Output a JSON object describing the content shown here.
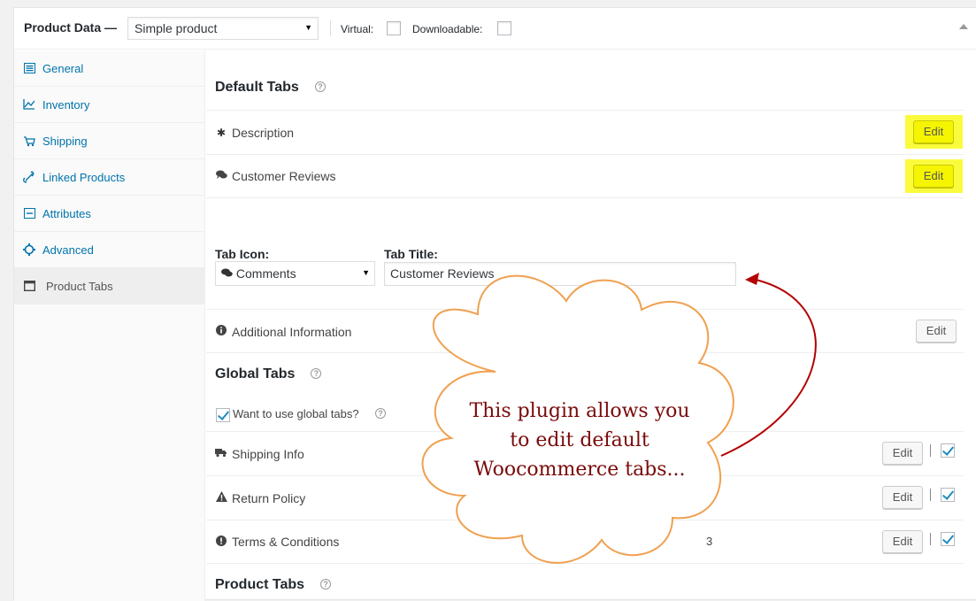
{
  "header": {
    "title": "Product Data —",
    "product_type": "Simple product",
    "virtual_label": "Virtual:",
    "downloadable_label": "Downloadable:"
  },
  "sidebar": {
    "items": [
      {
        "label": "General",
        "icon": "general-icon"
      },
      {
        "label": "Inventory",
        "icon": "inventory-icon"
      },
      {
        "label": "Shipping",
        "icon": "truck-icon"
      },
      {
        "label": "Linked Products",
        "icon": "link-icon"
      },
      {
        "label": "Attributes",
        "icon": "attributes-icon"
      },
      {
        "label": "Advanced",
        "icon": "gear-icon"
      },
      {
        "label": "Product Tabs",
        "icon": "window-icon",
        "active": true
      }
    ]
  },
  "default_tabs": {
    "title": "Default Tabs",
    "rows": [
      {
        "label": "Description",
        "icon": "asterisk-icon"
      },
      {
        "label": "Customer Reviews",
        "icon": "comments-icon"
      }
    ],
    "edit_label": "Edit",
    "form": {
      "icon_label": "Tab Icon:",
      "icon_value": "Comments",
      "title_label": "Tab Title:",
      "title_value": "Customer Reviews"
    },
    "additional": {
      "label": "Additional Information",
      "icon": "info-icon"
    }
  },
  "global_tabs": {
    "title": "Global Tabs",
    "use_label": "Want to use global tabs?",
    "rows": [
      {
        "label": "Shipping Info",
        "icon": "truck-icon"
      },
      {
        "label": "Return Policy",
        "icon": "warning-icon"
      },
      {
        "label": "Terms & Conditions",
        "icon": "exclamation-icon",
        "extra": "3"
      }
    ]
  },
  "product_tabs": {
    "title": "Product Tabs"
  },
  "callout": {
    "lines": [
      "This plugin allows you",
      "to edit default",
      "Woocommerce tabs..."
    ]
  },
  "colors": {
    "link": "#0073aa",
    "highlight": "#fbfb3e",
    "arrow": "#b30000",
    "cloud_stroke": "#f0a050"
  }
}
